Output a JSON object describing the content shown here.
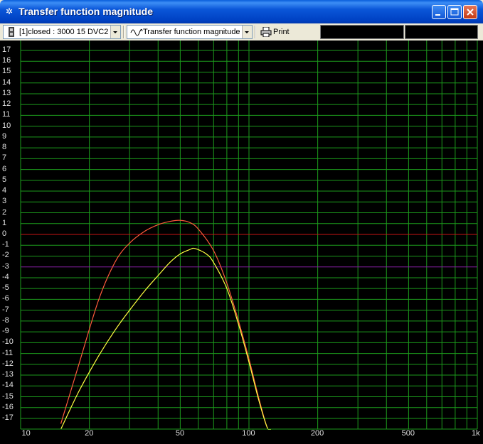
{
  "window": {
    "title": "Transfer function magnitude",
    "buttons": {
      "minimize": "minimize",
      "maximize": "maximize",
      "close": "close"
    }
  },
  "toolbar": {
    "system_select": "[1]closed : 3000 15 DVC2",
    "function_select": "Transfer function magnitude",
    "print_label": "Print"
  },
  "colors": {
    "grid": "#1c9a1c",
    "zero_line": "#c81414",
    "ref_line": "#8a1fa8",
    "curve_red": "#ff5a3c",
    "curve_yellow": "#ffff40"
  },
  "chart_data": {
    "type": "line",
    "x_scale": "log",
    "xlim": [
      10,
      1000
    ],
    "ylim": [
      -18,
      18
    ],
    "y_ticks": [
      "17",
      "16",
      "15",
      "14",
      "13",
      "12",
      "11",
      "10",
      "9",
      "8",
      "7",
      "6",
      "5",
      "4",
      "3",
      "2",
      "1",
      "0",
      "-1",
      "-2",
      "-3",
      "-4",
      "-5",
      "-6",
      "-7",
      "-8",
      "-9",
      "-10",
      "-11",
      "-12",
      "-13",
      "-14",
      "-15",
      "-16",
      "-17"
    ],
    "x_ticks": [
      "10",
      "20",
      "50",
      "100",
      "200",
      "500",
      "1k"
    ],
    "reference_line": -3,
    "series": [
      {
        "color": "red",
        "x": [
          15,
          18,
          22,
          26,
          30,
          35,
          40,
          45,
          50,
          55,
          60,
          70,
          80,
          90,
          100,
          110,
          120,
          125
        ],
        "y": [
          -17.5,
          -12,
          -6,
          -2.5,
          -0.8,
          0.3,
          0.9,
          1.2,
          1.3,
          1.1,
          0.5,
          -1.5,
          -4.5,
          -8,
          -11.5,
          -15,
          -17.8,
          -18
        ]
      },
      {
        "color": "yellow",
        "x": [
          15,
          18,
          22,
          26,
          30,
          35,
          40,
          45,
          50,
          55,
          58,
          65,
          70,
          80,
          90,
          100,
          110,
          120,
          125
        ],
        "y": [
          -18,
          -14.5,
          -11.2,
          -8.8,
          -7,
          -5.2,
          -3.8,
          -2.6,
          -1.8,
          -1.4,
          -1.3,
          -1.8,
          -2.6,
          -5,
          -8.3,
          -11.8,
          -15.2,
          -17.8,
          -18
        ]
      }
    ]
  }
}
